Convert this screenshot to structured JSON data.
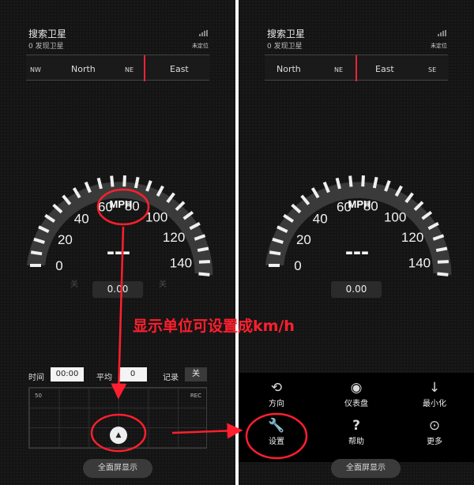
{
  "left": {
    "status": {
      "title": "搜索卫星",
      "sub": "0 发现卫星",
      "locate": "未定位"
    },
    "compass": {
      "nw": "NW",
      "north": "North",
      "ne": "NE",
      "east": "East"
    },
    "gauge": {
      "unit": "MPH",
      "speed": "---",
      "odometer": "0.00",
      "ticks": [
        "0",
        "20",
        "40",
        "60",
        "80",
        "100",
        "120",
        "140"
      ],
      "ghost1": "关",
      "ghost2": "关"
    },
    "stats": {
      "time_label": "时间",
      "time_value": "00:00",
      "avg_label": "平均",
      "avg_value": "0",
      "rec_label": "记录",
      "rec_toggle": "关"
    },
    "graph": {
      "ymax": "50",
      "rec": "REC"
    },
    "fab": "▲",
    "fullscreen": "全面屏显示"
  },
  "right": {
    "status": {
      "title": "搜索卫星",
      "sub": "0 发现卫星",
      "locate": "未定位"
    },
    "compass": {
      "north": "North",
      "ne": "NE",
      "east": "East",
      "se": "SE"
    },
    "gauge": {
      "unit": "MPH",
      "speed": "---",
      "odometer": "0.00",
      "ticks": [
        "0",
        "20",
        "40",
        "60",
        "80",
        "100",
        "120",
        "140"
      ]
    },
    "menu": {
      "direction": "方向",
      "dashboard": "仪表盘",
      "minimize": "最小化",
      "settings": "设置",
      "help": "帮助",
      "more": "更多"
    },
    "fullscreen": "全面屏显示"
  },
  "annotation": "显示单位可设置成km/h",
  "colors": {
    "annotation": "#ff1f2e",
    "background": "#141414"
  }
}
